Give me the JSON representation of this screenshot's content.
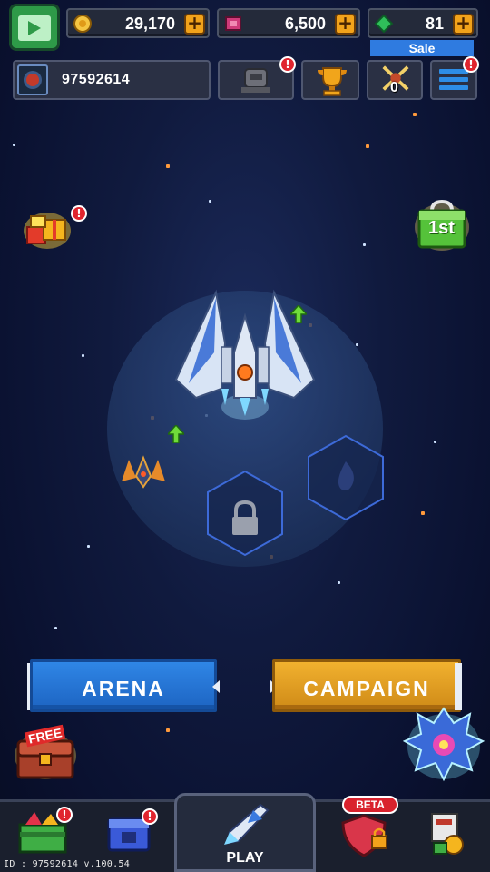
{
  "top": {
    "coins": "29,170",
    "tickets": "6,500",
    "gems": "81",
    "sale_label": "Sale",
    "plus": "+"
  },
  "profile": {
    "player_id": "97592614",
    "trophy_icon": "trophy-icon",
    "pvp_count": "0"
  },
  "badges": {
    "alert": "!"
  },
  "modes": {
    "arena": "ARENA",
    "campaign": "CAMPAIGN"
  },
  "chest": {
    "free_label": "FREE"
  },
  "shop": {
    "label": "1st"
  },
  "nav": {
    "play": "PLAY",
    "beta": "BETA"
  },
  "footer": {
    "text": "ID : 97592614  v.100.54"
  },
  "colors": {
    "arena": "#2f86e6",
    "campaign": "#f1b12f",
    "plus": "#f2a31b",
    "badge": "#e0252e",
    "sale": "#2f7be0"
  }
}
